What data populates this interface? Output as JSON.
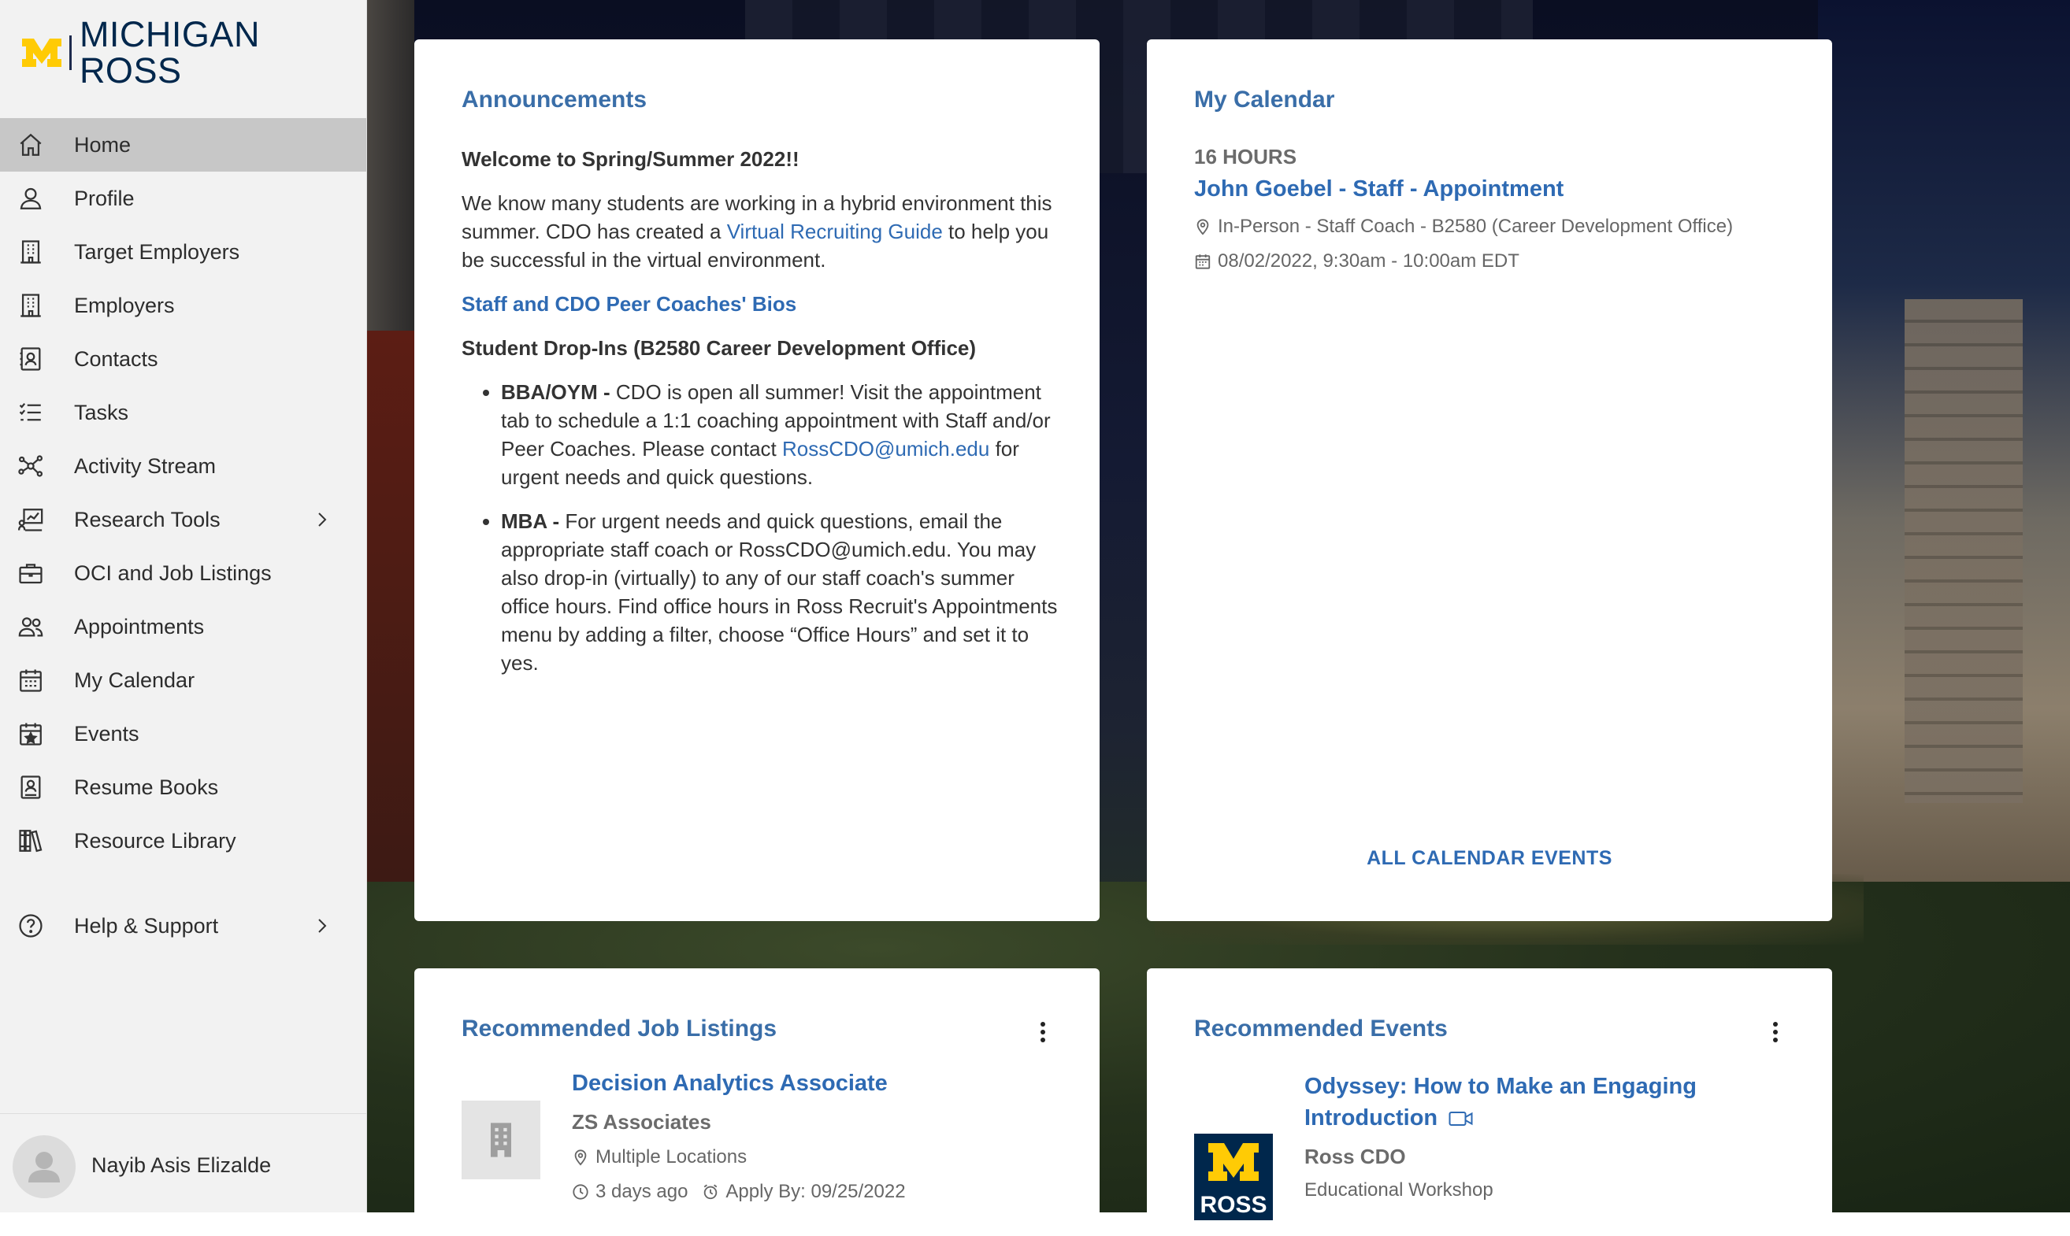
{
  "brand": {
    "name": "MICHIGAN ROSS",
    "logo_letter": "M",
    "accent": "#ffcb05",
    "navy": "#00274c"
  },
  "sidebar": {
    "items": [
      {
        "label": "Home",
        "icon": "home-icon",
        "active": true
      },
      {
        "label": "Profile",
        "icon": "user-icon"
      },
      {
        "label": "Target Employers",
        "icon": "building-icon"
      },
      {
        "label": "Employers",
        "icon": "building-icon"
      },
      {
        "label": "Contacts",
        "icon": "contact-card-icon"
      },
      {
        "label": "Tasks",
        "icon": "checklist-icon"
      },
      {
        "label": "Activity Stream",
        "icon": "network-icon"
      },
      {
        "label": "Research Tools",
        "icon": "chart-tools-icon",
        "submenu": true
      },
      {
        "label": "OCI and Job Listings",
        "icon": "briefcase-icon"
      },
      {
        "label": "Appointments",
        "icon": "people-icon"
      },
      {
        "label": "My Calendar",
        "icon": "calendar-icon"
      },
      {
        "label": "Events",
        "icon": "calendar-star-icon"
      },
      {
        "label": "Resume Books",
        "icon": "resume-book-icon"
      },
      {
        "label": "Resource Library",
        "icon": "library-icon"
      }
    ],
    "help": {
      "label": "Help & Support",
      "icon": "help-icon",
      "submenu": true
    },
    "user": {
      "name": "Nayib Asis Elizalde"
    }
  },
  "announcements": {
    "title": "Announcements",
    "welcome": "Welcome to Spring/Summer 2022!!",
    "intro_before": "We know many students are working in a hybrid environment this summer. CDO has created a ",
    "intro_link": "Virtual Recruiting Guide",
    "intro_after": " to help you be successful in the virtual environment.",
    "bios_link": "Staff and CDO Peer Coaches' Bios",
    "dropins_heading": "Student Drop-Ins (B2580 Career Development Office)",
    "bullet1_lead": "BBA/OYM - ",
    "bullet1_text": "CDO is open all summer! Visit the appointment tab to schedule a 1:1 coaching appointment with Staff and/or Peer Coaches. Please contact ",
    "bullet1_link": "RossCDO@umich.edu",
    "bullet1_after": " for urgent needs and quick questions.",
    "bullet2_lead": "MBA - ",
    "bullet2_text": "For urgent needs and quick questions, email the appropriate staff coach or RossCDO@umich.edu.  You may also drop-in (virtually) to any of our staff coach's summer office hours. Find office hours in Ross Recruit's Appointments menu by adding a filter, choose “Office Hours” and set it to yes."
  },
  "calendar": {
    "title": "My Calendar",
    "hours_label": "16 HOURS",
    "appointment_title": "John Goebel - Staff - Appointment",
    "location": "In-Person - Staff Coach - B2580 (Career Development Office)",
    "datetime": "08/02/2022, 9:30am - 10:00am EDT",
    "all_events_label": "ALL CALENDAR EVENTS"
  },
  "jobs": {
    "title": "Recommended Job Listings",
    "items": [
      {
        "title": "Decision Analytics Associate",
        "company": "ZS Associates",
        "location": "Multiple Locations",
        "posted": "3 days ago",
        "apply_by": "Apply By: 09/25/2022"
      }
    ]
  },
  "events": {
    "title": "Recommended Events",
    "items": [
      {
        "title": "Odyssey: How to Make an Engaging Introduction",
        "organizer": "Ross CDO",
        "type": "Educational Workshop",
        "thumb_text": "ROSS"
      }
    ]
  }
}
